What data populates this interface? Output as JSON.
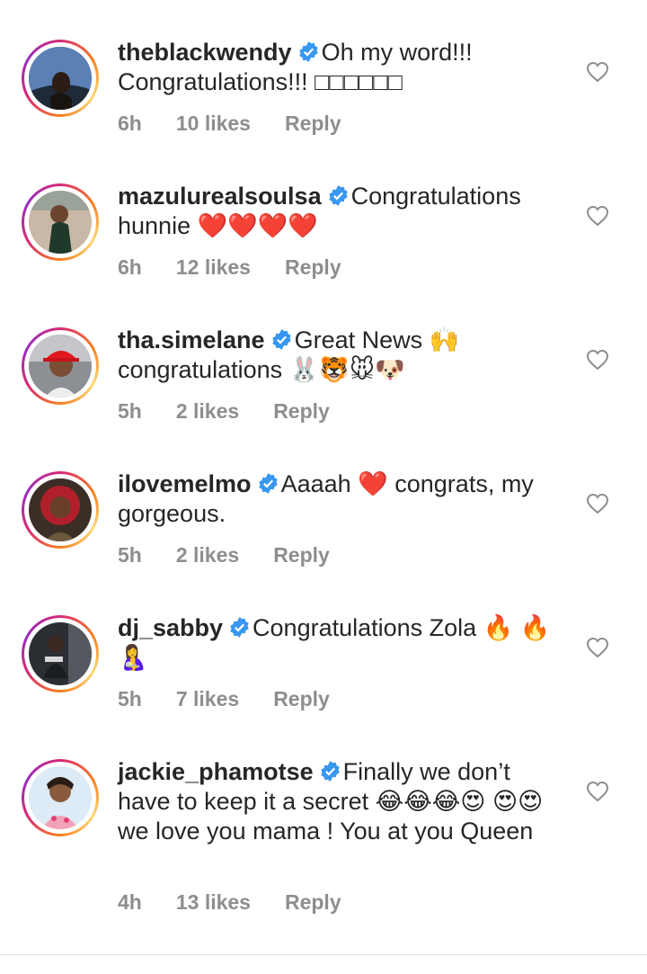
{
  "colors": {
    "verified": "#3897f0",
    "meta": "#8e8e8e",
    "text": "#262626"
  },
  "icons": {
    "verified": "verified-badge-icon",
    "like": "heart-outline-icon"
  },
  "comments": [
    {
      "username": "theblackwendy",
      "text": "Oh my word!!! Congratulations!!! □□□□□□",
      "time": "6h",
      "likes": "10 likes",
      "reply": "Reply"
    },
    {
      "username": "mazulurealsoulsa",
      "text": "Congratulations hunnie ❤️❤️❤️❤️",
      "time": "6h",
      "likes": "12 likes",
      "reply": "Reply"
    },
    {
      "username": "tha.simelane",
      "text": "Great News 🙌 congratulations 🐰🐯🐭🐶",
      "time": "5h",
      "likes": "2 likes",
      "reply": "Reply"
    },
    {
      "username": "ilovemelmo",
      "text": "Aaaah ❤️ congrats, my gorgeous.",
      "time": "5h",
      "likes": "2 likes",
      "reply": "Reply"
    },
    {
      "username": "dj_sabby",
      "text": "Congratulations Zola 🔥 🔥 🤱",
      "time": "5h",
      "likes": "7 likes",
      "reply": "Reply"
    },
    {
      "username": "jackie_phamotse",
      "text": "Finally we don’t have to keep it a secret 😂😂😂😍 😍😍 we love you mama ! You at you Queen",
      "time": "4h",
      "likes": "13 likes",
      "reply": "Reply"
    }
  ]
}
